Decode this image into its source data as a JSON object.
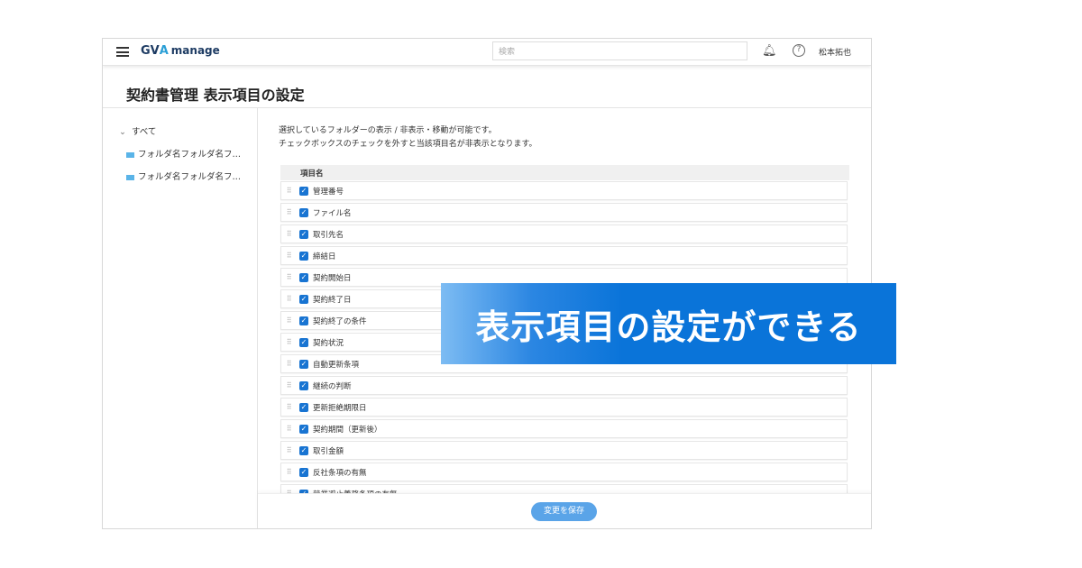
{
  "header": {
    "logo": "GVA manage",
    "logo_brand": "GV",
    "logo_brand_accent": "A",
    "logo_suffix": "manage",
    "search_placeholder": "検索",
    "user": "松本拓也"
  },
  "page": {
    "title": "契約書管理 表示項目の設定"
  },
  "sidebar": {
    "root": "すべて",
    "folders": [
      "フォルダ名フォルダ名フ…",
      "フォルダ名フォルダ名フ…"
    ]
  },
  "main": {
    "description": [
      "選択しているフォルダーの表示 / 非表示・移動が可能です。",
      "チェックボックスのチェックを外すと当該項目名が非表示となります。"
    ],
    "column_header": "項目名",
    "items": [
      {
        "label": "管理番号",
        "checked": true
      },
      {
        "label": "ファイル名",
        "checked": true
      },
      {
        "label": "取引先名",
        "checked": true
      },
      {
        "label": "締結日",
        "checked": true
      },
      {
        "label": "契約開始日",
        "checked": true
      },
      {
        "label": "契約終了日",
        "checked": true
      },
      {
        "label": "契約終了の条件",
        "checked": true
      },
      {
        "label": "契約状況",
        "checked": true
      },
      {
        "label": "自動更新条項",
        "checked": true
      },
      {
        "label": "継続の判断",
        "checked": true
      },
      {
        "label": "更新拒絶期限日",
        "checked": true
      },
      {
        "label": "契約期間（更新後）",
        "checked": true
      },
      {
        "label": "取引金額",
        "checked": true
      },
      {
        "label": "反社条項の有無",
        "checked": true
      },
      {
        "label": "競業避止義務条項の有無",
        "checked": true
      }
    ],
    "save_label": "変更を保存"
  },
  "banner": {
    "text": "表示項目の設定ができる"
  }
}
